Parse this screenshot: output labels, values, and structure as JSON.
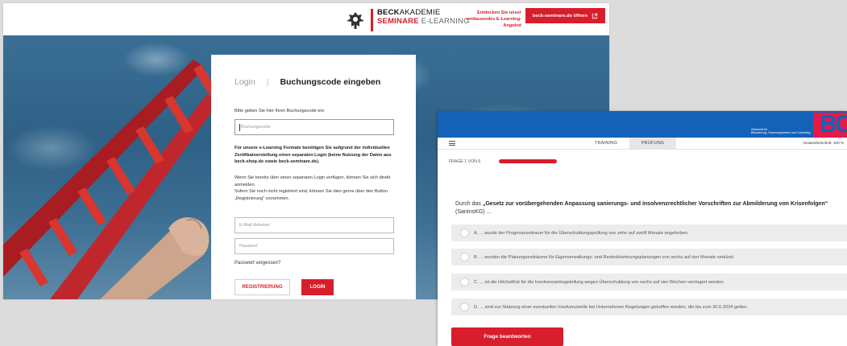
{
  "login_window": {
    "brand": {
      "line1_bold": "BECK",
      "line1_rest": "AKADEMIE",
      "line2_bold": "SEMINARE",
      "line2_rest": "E-LEARNING"
    },
    "promo": {
      "line1": "Entdecken Sie unser",
      "line2": "umfassendes E-Learning-Angebot",
      "button_label": "beck-seminare.de öffnen"
    },
    "card": {
      "tab_login": "Login",
      "tab_separator": "|",
      "tab_code": "Buchungscode eingeben",
      "code_prompt": "Bitte geben Sie hier Ihren Buchungscode ein:",
      "code_placeholder": "Buchungscode",
      "notice_bold": "Für unsere e-Learning Formate benötigen Sie aufgrund der individuellen Zertifikatserstellung einen separaten Login (keine Nutzung der Daten aus beck-shop.de sowie beck-seminare.de).",
      "info1": "Wenn Sie bereits über einen separaten Login verfügen, können Sie sich direkt anmelden.",
      "info2": "Sofern Sie noch nicht registriert sind, können Sie dies gerne über den Button „Registrierung“ vornehmen.",
      "email_placeholder": "E-Mail-Adresse",
      "password_placeholder": "Passwort",
      "forgot": "Passwort vergessen?",
      "register_label": "REGISTRIERUNG",
      "login_label": "LOGIN"
    }
  },
  "quiz_window": {
    "logo_caption_line1": "Zeitschrift für",
    "logo_caption_line2": "Bilanzierung, Rechnungswesen und Controlling",
    "logo_letters": "BC",
    "nav": {
      "training": "TRAINING",
      "pruefung": "PRÜFUNG",
      "overall_progress": "Gesamtfortschritt: 100 %"
    },
    "question_counter": "FRAGE 1 VON 6",
    "question": {
      "prefix": "Durch das ",
      "law_bold": "„Gesetz zur vorübergehenden Anpassung sanierungs- und insolvenzrechtlicher Vorschriften zur Abmilderung von Krisenfolgen“",
      "suffix": " (SanInsKG) ..."
    },
    "answers": [
      "A. ... wurde der Prognosezeitraum für die Überschuldungsprüfung von zehn auf zwölf Monate angehoben.",
      "B. ... wurden die Planungszeiträume für Eigenverwaltungs- und Restrukturierungsplanungen von sechs auf vier Monate verkürzt.",
      "C. ... ist die Höchstfrist für die Insolvenzantragstellung wegen Überschuldung von sechs auf vier Wochen verringert worden.",
      "D. ... sind zur Stützung einer eventuellen Insolvenzwelle bei Unternehmen Regelungen getroffen worden, die bis zum 30.6.2024 gelten."
    ],
    "submit_label": "Frage beantworten"
  },
  "colors": {
    "accent_red": "#d81e2c",
    "quiz_header_blue": "#1462b8",
    "logo_pink": "#e6194b"
  }
}
